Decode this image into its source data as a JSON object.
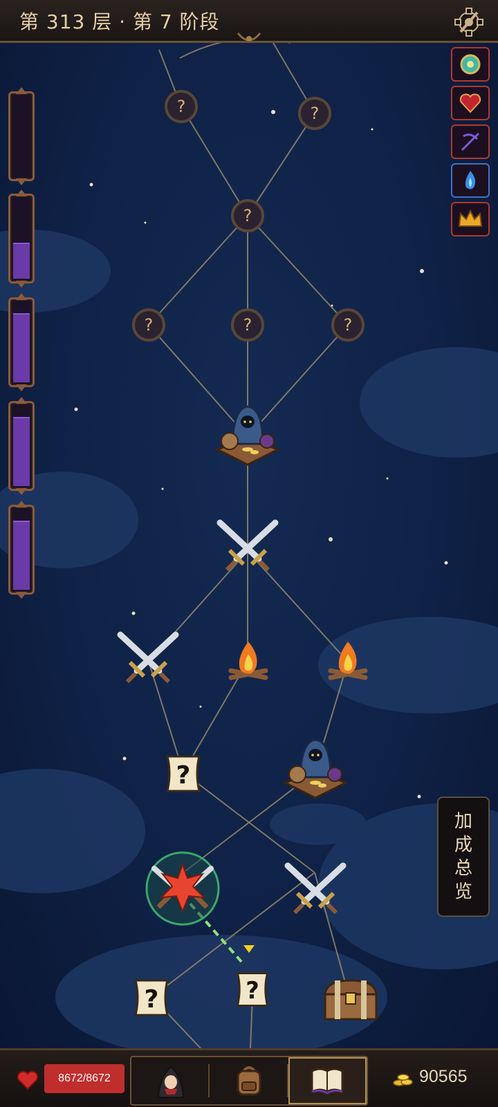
{
  "header": {
    "title": "第 313 层 · 第 7 阶段",
    "settings_icon": "gear-icon"
  },
  "progress_bars": [
    {
      "fill": 0
    },
    {
      "fill": 0.45
    },
    {
      "fill": 0.85
    },
    {
      "fill": 0.85
    },
    {
      "fill": 0.85
    }
  ],
  "buffs": [
    {
      "icon": "orb-icon",
      "border": "#b0382f"
    },
    {
      "icon": "heart-icon",
      "border": "#b0382f"
    },
    {
      "icon": "crossbow-icon",
      "border": "#b0382f"
    },
    {
      "icon": "blue-flame-icon",
      "border": "#3a74c8"
    },
    {
      "icon": "crown-icon",
      "border": "#b0382f"
    }
  ],
  "bonus_panel": {
    "chars": [
      "加",
      "成",
      "总",
      "览"
    ]
  },
  "player": {
    "hp": "8672/8672",
    "gold": "90565"
  },
  "bottom_tabs": [
    {
      "icon": "hero-icon"
    },
    {
      "icon": "backpack-icon"
    },
    {
      "icon": "spellbook-icon",
      "active": true
    }
  ],
  "colors": {
    "accent": "#b39256",
    "hp": "#c02d2d",
    "mana": "#6a3aa8",
    "path": "#8fe07a"
  }
}
